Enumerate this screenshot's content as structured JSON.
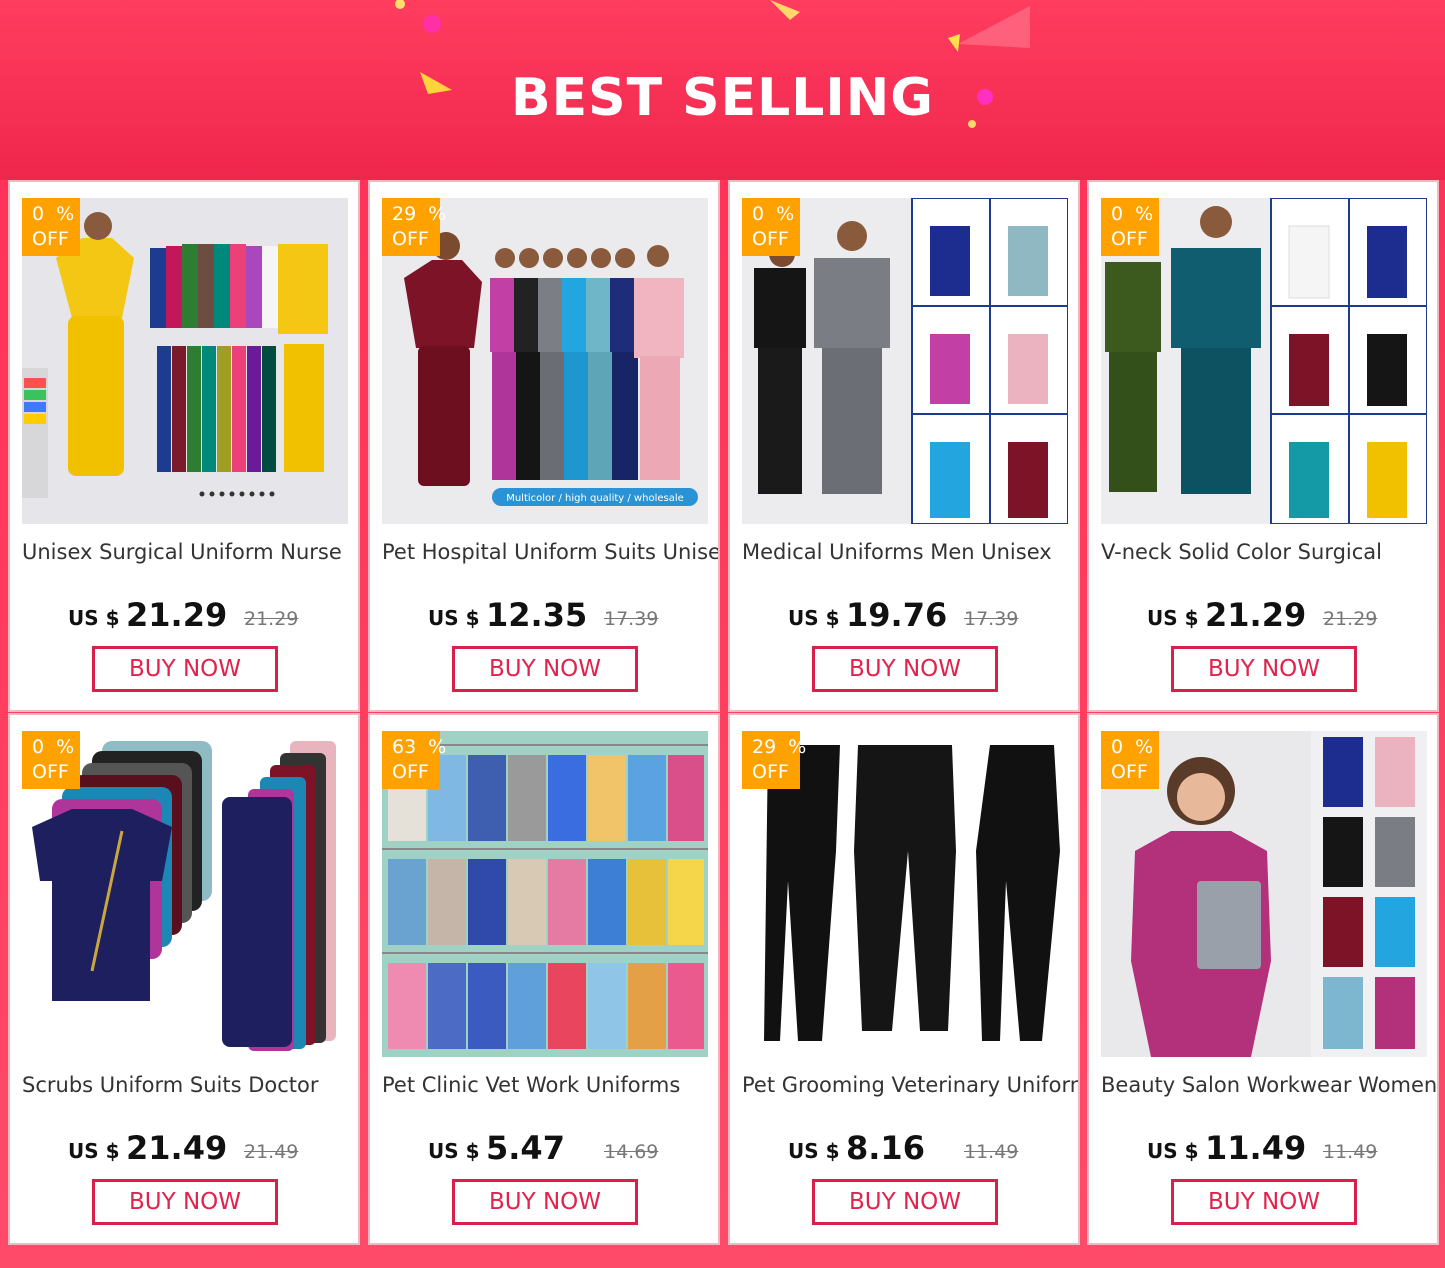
{
  "header": {
    "title": "BEST SELLING"
  },
  "products": [
    {
      "discount": "0  %",
      "off": "OFF",
      "name": "Unisex Surgical Uniform Nurse",
      "currency": "US $",
      "price": "21.29",
      "original": "21.29",
      "cta": "BUY NOW",
      "tone": "#f3c713"
    },
    {
      "discount": "29  %",
      "off": "OFF",
      "name": "Pet Hospital Uniform Suits Unisex",
      "currency": "US $",
      "price": "12.35",
      "original": "17.39",
      "cta": "BUY NOW",
      "tone": "#7d1326",
      "banner": "Multicolor / high quality / wholesale"
    },
    {
      "discount": "0  %",
      "off": "OFF",
      "name": "Medical Uniforms Men Unisex",
      "currency": "US $",
      "price": "19.76",
      "original": "17.39",
      "cta": "BUY NOW",
      "tone": "#7a7d84"
    },
    {
      "discount": "0  %",
      "off": "OFF",
      "name": "V-neck Solid Color Surgical",
      "currency": "US $",
      "price": "21.29",
      "original": "21.29",
      "cta": "BUY NOW",
      "tone": "#0f5d6e"
    },
    {
      "discount": "0  %",
      "off": "OFF",
      "name": "Scrubs Uniform Suits Doctor",
      "currency": "US $",
      "price": "21.49",
      "original": "21.49",
      "cta": "BUY NOW",
      "tone": "#1d1f5e"
    },
    {
      "discount": "63  %",
      "off": "OFF",
      "name": "Pet Clinic Vet Work Uniforms",
      "currency": "US $",
      "price": "5.47",
      "original": "14.69",
      "cta": "BUY NOW",
      "tone": "#9fd1c4"
    },
    {
      "discount": "29  %",
      "off": "OFF",
      "name": "Pet Grooming Veterinary Uniform",
      "currency": "US $",
      "price": "8.16",
      "original": "11.49",
      "cta": "BUY NOW",
      "tone": "#111111"
    },
    {
      "discount": "0  %",
      "off": "OFF",
      "name": "Beauty Salon Workwear Women",
      "currency": "US $",
      "price": "11.49",
      "original": "11.49",
      "cta": "BUY NOW",
      "tone": "#b3307a"
    }
  ]
}
